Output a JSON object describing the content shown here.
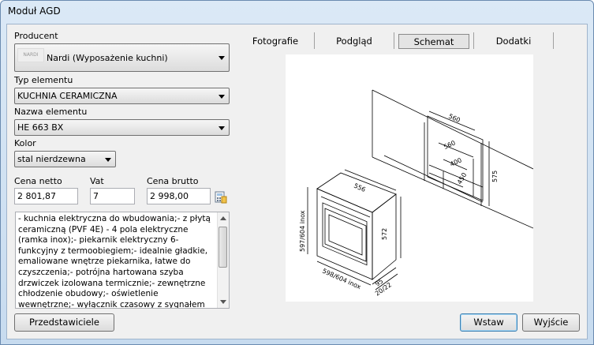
{
  "window": {
    "title": "Moduł AGD"
  },
  "producer": {
    "label": "Producent",
    "value": "Nardi (Wyposażenie kuchni)",
    "logo_text": "NARDI"
  },
  "type": {
    "label": "Typ elementu",
    "value": "KUCHNIA CERAMICZNA"
  },
  "name": {
    "label": "Nazwa elementu",
    "value": "HE 663 BX"
  },
  "color": {
    "label": "Kolor",
    "value": "stal nierdzewna"
  },
  "price": {
    "net_label": "Cena netto",
    "net_value": "2 801,87",
    "vat_label": "Vat",
    "vat_value": "7",
    "gross_label": "Cena brutto",
    "gross_value": "2 998,00"
  },
  "description": "- kuchnia elektryczna do wbudowania;- z płytą ceramiczną (PVF 4E) - 4 pola elektryczne (ramka inox);- piekarnik elektryczny 6-funkcyjny z termoobiegiem;- idealnie gładkie, emaliowane wnętrze piekarnika, łatwe do   czyszczenia;- potrójna hartowana szyba drzwiczek izolowana termicznie;- zewnętrzne chłodzenie obudowy;- oświetlenie wewnętrzne;- wyłącznik czasowy z sygnałem końca pieczenia;- opiekacz (górny, dolny);- grill;- nawiew",
  "tabs": [
    {
      "label": "Fotografie"
    },
    {
      "label": "Podgląd"
    },
    {
      "label": "Schemat"
    },
    {
      "label": "Dodatki"
    }
  ],
  "drawing": {
    "dims": [
      "560",
      "560",
      "400",
      "450",
      "575",
      "556",
      "572",
      "597/604 inox",
      "598/604 inox",
      "95",
      "20/22"
    ]
  },
  "buttons": {
    "reps": "Przedstawiciele",
    "insert": "Wstaw",
    "exit": "Wyjście"
  }
}
